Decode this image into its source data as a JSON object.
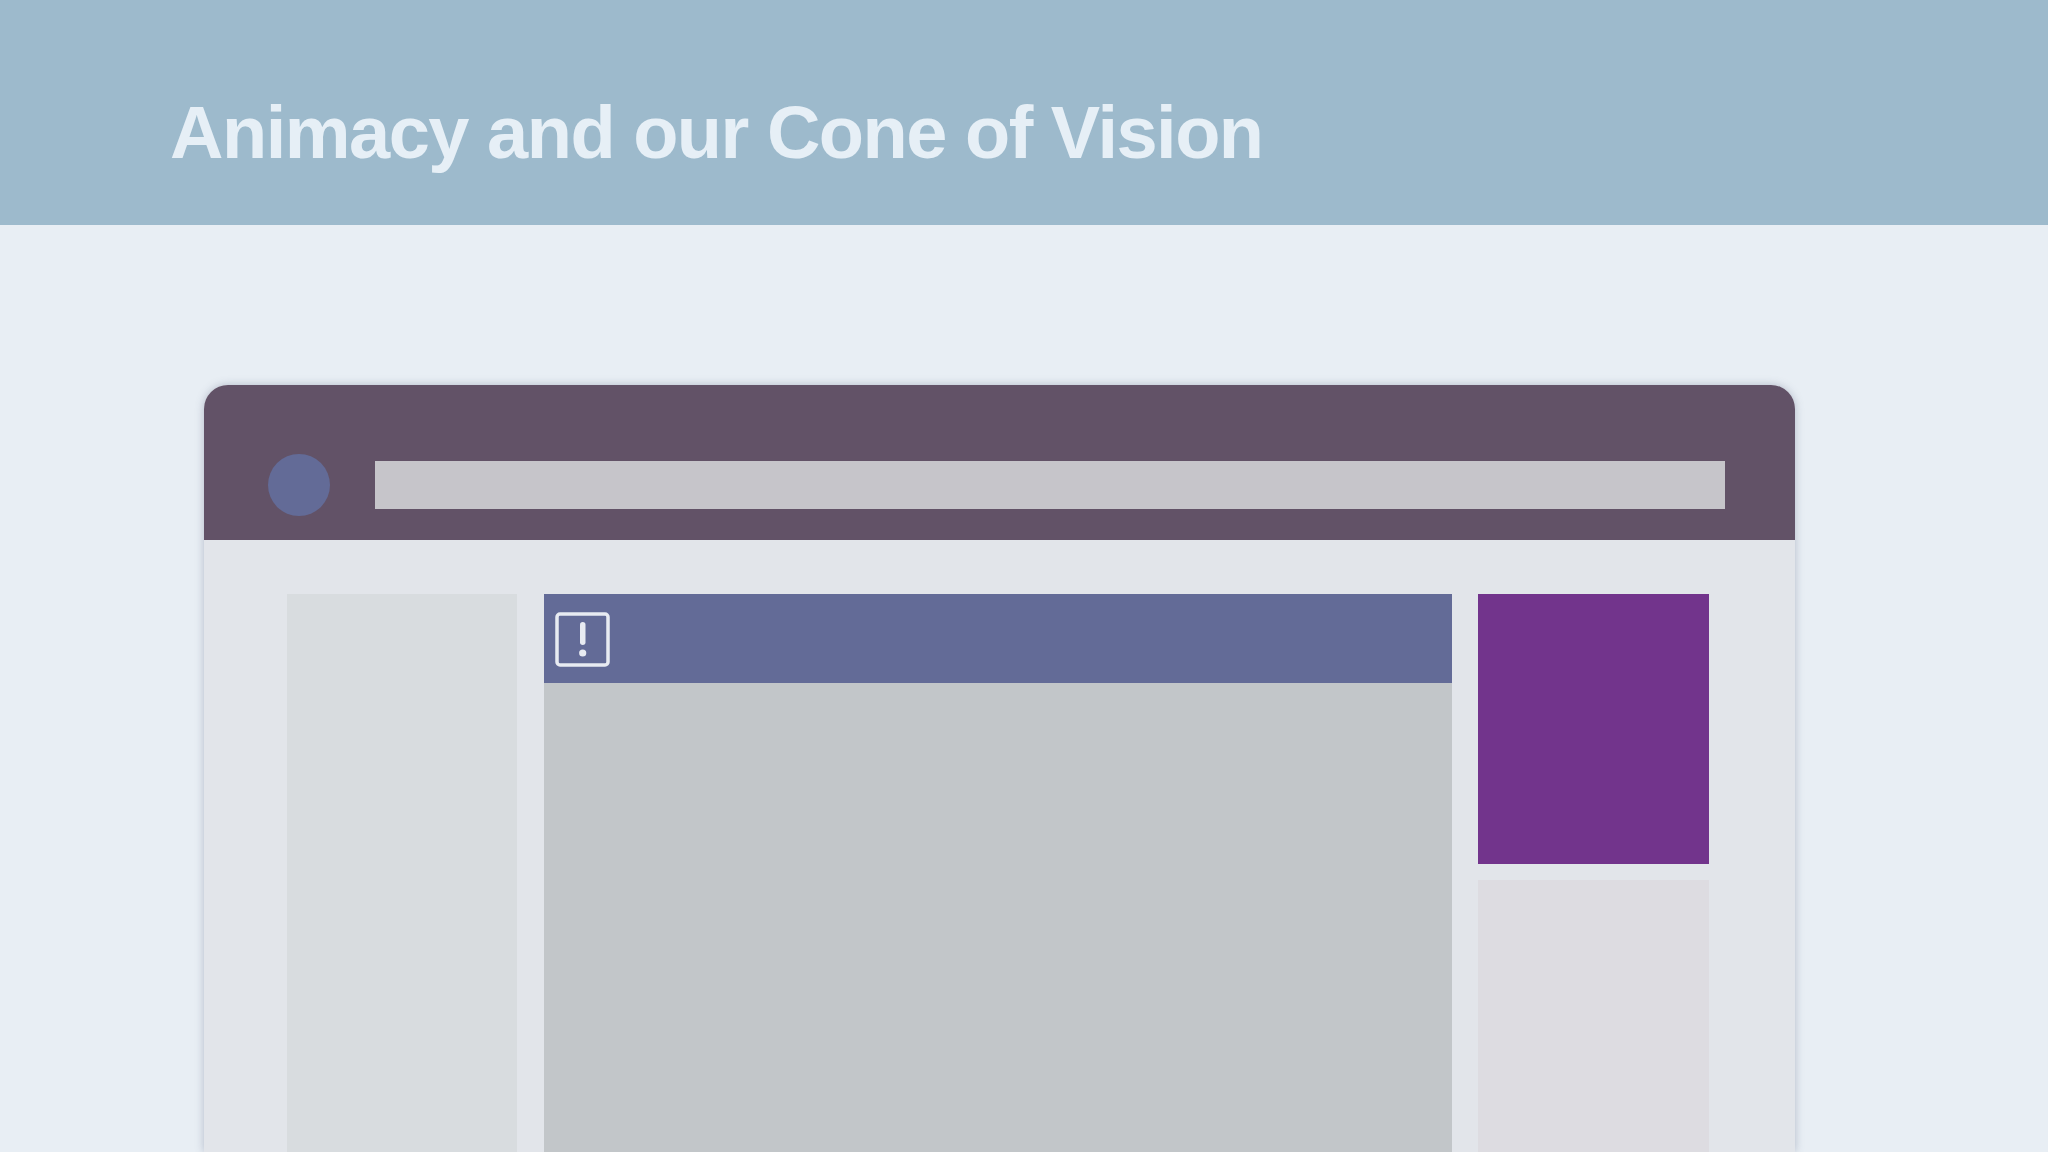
{
  "slide": {
    "title": "Animacy and our Cone of Vision"
  }
}
